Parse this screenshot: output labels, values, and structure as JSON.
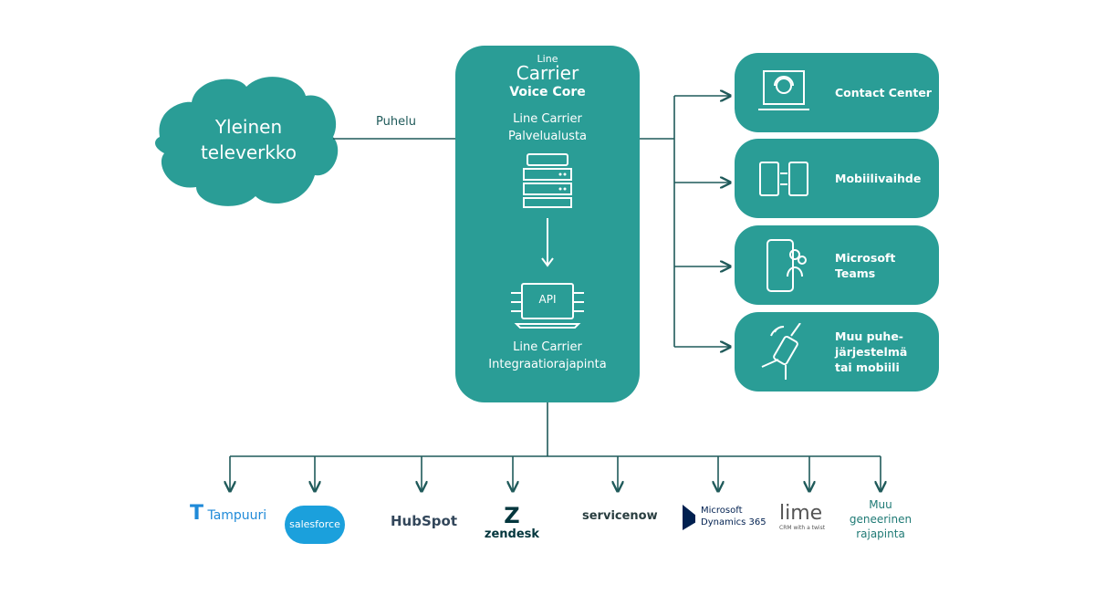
{
  "cloud": {
    "line1": "Yleinen",
    "line2": "televerkko"
  },
  "edge_label": "Puhelu",
  "core": {
    "logo_line1": "Line",
    "logo_line2": "Carrier",
    "title": "Voice Core",
    "platform_line1": "Line Carrier",
    "platform_line2": "Palvelualusta",
    "api_label": "API",
    "api_line1": "Line Carrier",
    "api_line2": "Integraatiorajapinta"
  },
  "targets": [
    {
      "line1": "Contact Center",
      "line2": "",
      "icon": "headset-laptop-icon"
    },
    {
      "line1": "Mobiilivaihde",
      "line2": "",
      "icon": "phones-transfer-icon"
    },
    {
      "line1": "Microsoft",
      "line2": "Teams",
      "icon": "phone-team-icon"
    },
    {
      "line1": "Muu puhe-",
      "line2": "järjestelmä",
      "line3": "tai mobiili",
      "icon": "wireless-device-icon"
    }
  ],
  "integrations": [
    "Tampuuri",
    "salesforce",
    "HubSpot",
    "zendesk",
    "servicenow",
    "Microsoft",
    "Dynamics 365",
    "lime",
    "CRM with a twist",
    "Muu",
    "geneerinen",
    "rajapinta"
  ],
  "colors": {
    "teal": "#2a9d96",
    "line": "#1f5a5a"
  }
}
